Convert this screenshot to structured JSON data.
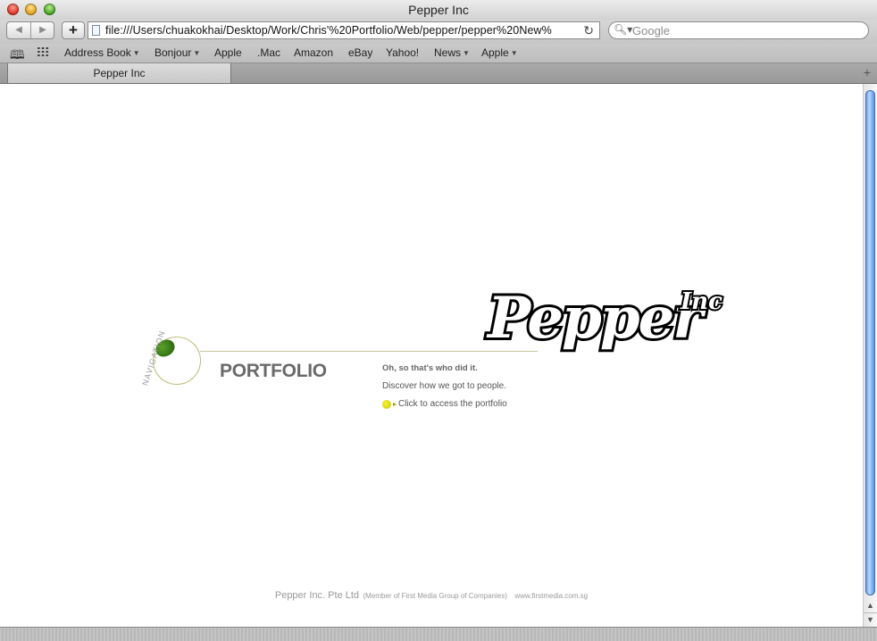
{
  "window": {
    "title": "Pepper Inc"
  },
  "toolbar": {
    "back_icon": "back-arrow-icon",
    "forward_icon": "forward-arrow-icon",
    "add_label": "+",
    "url": "file:///Users/chuakokhai/Desktop/Work/Chris'%20Portfolio/Web/pepper/pepper%20New%",
    "reload_icon": "reload-icon",
    "search_placeholder": "Google"
  },
  "bookmarks": {
    "items": [
      {
        "label": "Address Book",
        "dropdown": true
      },
      {
        "label": "Bonjour",
        "dropdown": true
      },
      {
        "label": "Apple",
        "dropdown": false
      },
      {
        "label": ".Mac",
        "dropdown": false
      },
      {
        "label": "Amazon",
        "dropdown": false
      },
      {
        "label": "eBay",
        "dropdown": false
      },
      {
        "label": "Yahoo!",
        "dropdown": false
      },
      {
        "label": "News",
        "dropdown": true
      },
      {
        "label": "Apple",
        "dropdown": true
      }
    ]
  },
  "tabs": [
    {
      "label": "Pepper Inc",
      "active": true
    }
  ],
  "page": {
    "nav_label": "NAVIGATION",
    "section_title": "PORTFOLIO",
    "tagline": "Oh, so that's who did it.",
    "discover": "Discover how we got to people.",
    "access_link": "Click to access the portfolio",
    "logo": {
      "text": "Pepper",
      "suffix": "Inc"
    },
    "footer": {
      "company": "Pepper Inc. Pte Ltd",
      "member": "(Member of First Media Group of Companies)",
      "url": "www.firstmedia.com.sg"
    }
  },
  "colors": {
    "accent_green": "#2f6e12",
    "accent_yellow": "#e0e020",
    "scroll_blue": "#5a8fd8"
  }
}
